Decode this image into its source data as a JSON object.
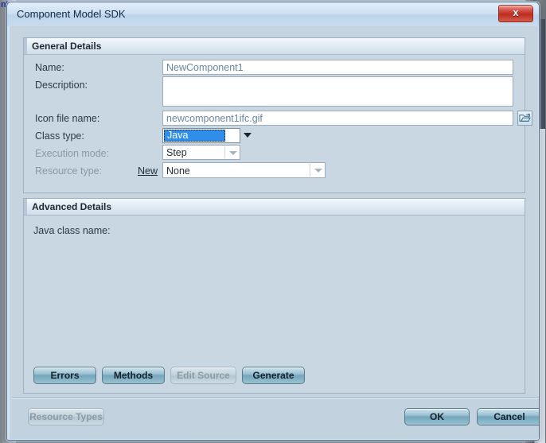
{
  "background": {
    "fragment_text": "n'",
    "scrollbar_name": "vertical-scrollbar"
  },
  "window": {
    "title": "Component Model SDK",
    "close_label": "x"
  },
  "general_panel": {
    "header": "General Details",
    "fields": {
      "name_label": "Name:",
      "name_value": "NewComponent1",
      "description_label": "Description:",
      "description_value": "",
      "icon_label": "Icon file name:",
      "icon_value": "newcomponent1ifc.gif",
      "browse_icon": "folder-open-icon",
      "class_type_label": "Class type:",
      "class_type_value": "Java",
      "execution_mode_label": "Execution mode:",
      "execution_mode_value": "Step",
      "resource_type_label": "Resource type:",
      "resource_type_new_link": "New",
      "resource_type_value": "None"
    }
  },
  "advanced_panel": {
    "header": "Advanced Details",
    "java_class_name_label": "Java class name:",
    "buttons": [
      {
        "label": "Errors",
        "disabled": false
      },
      {
        "label": "Methods",
        "disabled": false
      },
      {
        "label": "Edit Source",
        "disabled": true
      },
      {
        "label": "Generate",
        "disabled": false
      }
    ]
  },
  "footer": {
    "resource_types_label": "Resource Types",
    "ok_label": "OK",
    "cancel_label": "Cancel"
  },
  "colors": {
    "dialog_body": "#c6d4e0",
    "titlebar": "#cfe0f1",
    "close_red": "#bb2d21",
    "selection_blue": "#2f8eea",
    "button_teal": "#74a6bb",
    "input_text": "#6a86a4"
  }
}
